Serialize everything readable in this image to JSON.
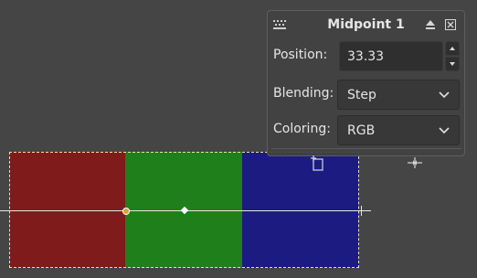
{
  "colors": {
    "background": "#454545",
    "band_red": "#7f1b1b",
    "band_green": "#1f7f1b",
    "band_blue": "#1b1b82",
    "handle_start": "#e39b3a"
  },
  "panel": {
    "title": "Midpoint 1",
    "position_label": "Position:",
    "position_value": "33.33",
    "blending_label": "Blending:",
    "blending_value": "Step",
    "coloring_label": "Coloring:",
    "coloring_value": "RGB"
  },
  "icons": {
    "grip": "grip-icon",
    "collapse": "eject-icon",
    "close": "close-icon",
    "new_point": "new-point-icon",
    "split": "split-icon"
  }
}
